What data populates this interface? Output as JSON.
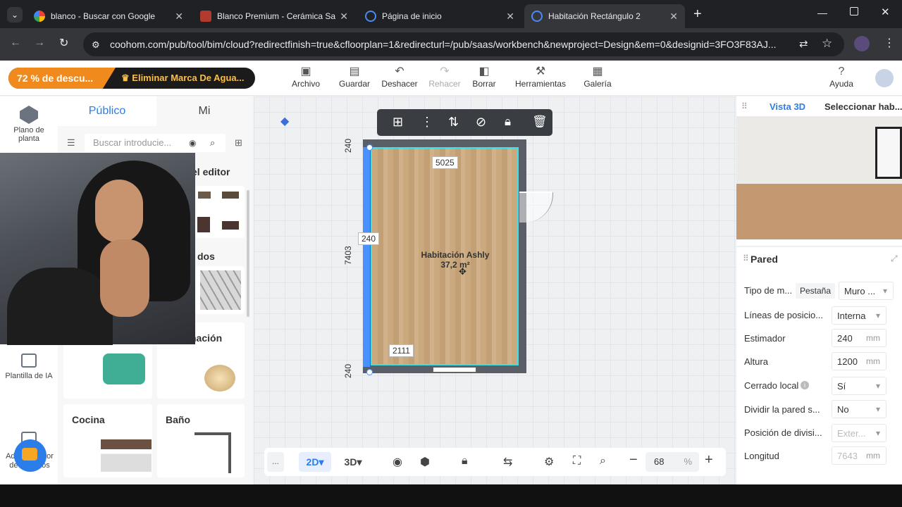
{
  "browser": {
    "tabs": [
      {
        "title": "blanco - Buscar con Google",
        "icon": "google-icon"
      },
      {
        "title": "Blanco Premium - Cerámica San Lo",
        "icon": "ceramica-icon"
      },
      {
        "title": "Página de inicio",
        "icon": "coohom-icon"
      },
      {
        "title": "Habitación Rectángulo 2",
        "icon": "coohom-icon"
      }
    ],
    "url": "coohom.com/pub/tool/bim/cloud?redirectfinish=true&cfloorplan=1&redirecturl=/pub/saas/workbench&newproject=Design&em=0&designid=3FO3F83AJ..."
  },
  "promo": {
    "discount": "72 % de descu...",
    "watermark": "Eliminar Marca De Agua..."
  },
  "toolbar": {
    "items": [
      "Archivo",
      "Guardar",
      "Deshacer",
      "Rehacer",
      "Borrar",
      "Herramientas",
      "Galería"
    ],
    "help": "Ayuda"
  },
  "leftrail": {
    "floorplan": "Plano de planta",
    "ai_template": "Plantilla de IA",
    "admin": "Administrador de recursos"
  },
  "panel": {
    "tabs": [
      "Público",
      "Mi"
    ],
    "search_placeholder": "Buscar introducie...",
    "sections": [
      "el editor",
      "dos",
      "nación"
    ],
    "categories": [
      "Cocina",
      "Baño"
    ]
  },
  "plan": {
    "room_name": "Habitación Ashly",
    "room_area": "37,2 m²",
    "dims": {
      "top": "5025",
      "left_mid": "240",
      "vertical": "7403",
      "top_left": "240",
      "bottom_left": "240",
      "bottom": "2111"
    }
  },
  "right": {
    "tabs": [
      "Vista 3D",
      "Seleccionar hab..."
    ],
    "section": "Pared",
    "props": [
      {
        "label": "Tipo de m...",
        "tab": "Pestaña",
        "value": "Muro ..."
      },
      {
        "label": "Líneas de posicio...",
        "value": "Interna"
      },
      {
        "label": "Estimador",
        "value": "240",
        "unit": "mm"
      },
      {
        "label": "Altura",
        "value": "1200",
        "unit": "mm"
      },
      {
        "label": "Cerrado local",
        "value": "Sí"
      },
      {
        "label": "Dividir la pared s...",
        "value": "No"
      },
      {
        "label": "Posición de divisi...",
        "value": "Exter..."
      },
      {
        "label": "Longitud",
        "value": "7643",
        "unit": "mm"
      }
    ]
  },
  "bottom": {
    "mode2d": "2D",
    "mode3d": "3D",
    "zoom": "68",
    "zoom_unit": "%",
    "more": "..."
  }
}
